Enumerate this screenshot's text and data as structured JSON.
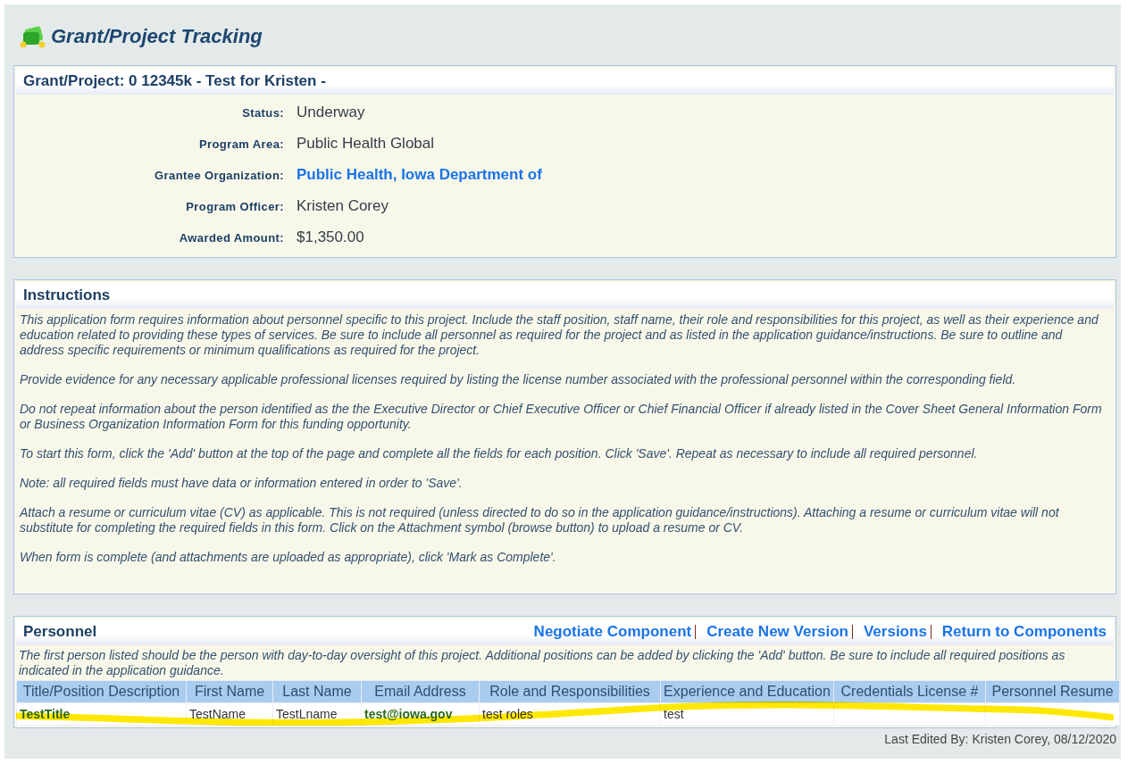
{
  "page_title": "Grant/Project Tracking",
  "project": {
    "title": "Grant/Project: 0 12345k - Test for Kristen -",
    "fields": [
      {
        "label": "Status:",
        "value": "Underway",
        "kind": "text"
      },
      {
        "label": "Program Area:",
        "value": "Public Health Global",
        "kind": "text"
      },
      {
        "label": "Grantee Organization:",
        "value": "Public Health, Iowa Department of",
        "kind": "link"
      },
      {
        "label": "Program Officer:",
        "value": "Kristen Corey",
        "kind": "text"
      },
      {
        "label": "Awarded Amount:",
        "value": "$1,350.00",
        "kind": "text"
      }
    ]
  },
  "instructions": {
    "title": "Instructions",
    "paragraphs": [
      "This application form requires information about personnel specific to this project. Include the staff position, staff name, their role and responsibilities for this project, as well as their experience and education related to providing these types of services. Be sure to include all personnel as required for the project and as listed in the application guidance/instructions. Be sure to outline and address specific requirements or minimum qualifications as required for the project.",
      "Provide evidence for any necessary applicable professional licenses required by listing the license number associated with the professional personnel within the corresponding field.",
      "Do not repeat information about the person identified as the the Executive Director or Chief Executive Officer or Chief Financial Officer if already listed in the Cover Sheet General Information Form or Business Organization Information Form for this funding opportunity.",
      "To start this form, click the 'Add' button at the top of the page and complete all the fields for each position. Click 'Save'. Repeat as necessary to include all required personnel.",
      "Note: all required fields must have data or information entered in order to 'Save'.",
      "Attach a resume or curriculum vitae (CV) as applicable. This is not required (unless directed to do so in the application guidance/instructions). Attaching a resume or curriculum vitae will not substitute for completing the required fields in this form. Click on the Attachment symbol (browse button) to upload a resume or CV.",
      "When form is complete (and attachments are uploaded as appropriate), click 'Mark as Complete'."
    ]
  },
  "personnel": {
    "title": "Personnel",
    "links": [
      "Negotiate Component",
      "Create New Version",
      "Versions",
      "Return to Components"
    ],
    "note": "The first person listed should be the person with day-to-day oversight of this project. Additional positions can be added by clicking the 'Add' button. Be sure to include all required positions as indicated in the application guidance.",
    "table": {
      "columns": [
        "Title/Position Description",
        "First Name",
        "Last Name",
        "Email Address",
        "Role and Responsibilities",
        "Experience and Education",
        "Credentials License #",
        "Personnel Resume"
      ],
      "rows": [
        {
          "cells": [
            {
              "text": "TestTitle",
              "kind": "link"
            },
            {
              "text": "TestName",
              "kind": "text"
            },
            {
              "text": "TestLname",
              "kind": "text"
            },
            {
              "text": "test@iowa.gov",
              "kind": "link"
            },
            {
              "text": "test roles",
              "kind": "text"
            },
            {
              "text": "test",
              "kind": "text"
            }
          ]
        }
      ]
    }
  },
  "footer": "Last Edited By: Kristen Corey, 08/12/2020"
}
